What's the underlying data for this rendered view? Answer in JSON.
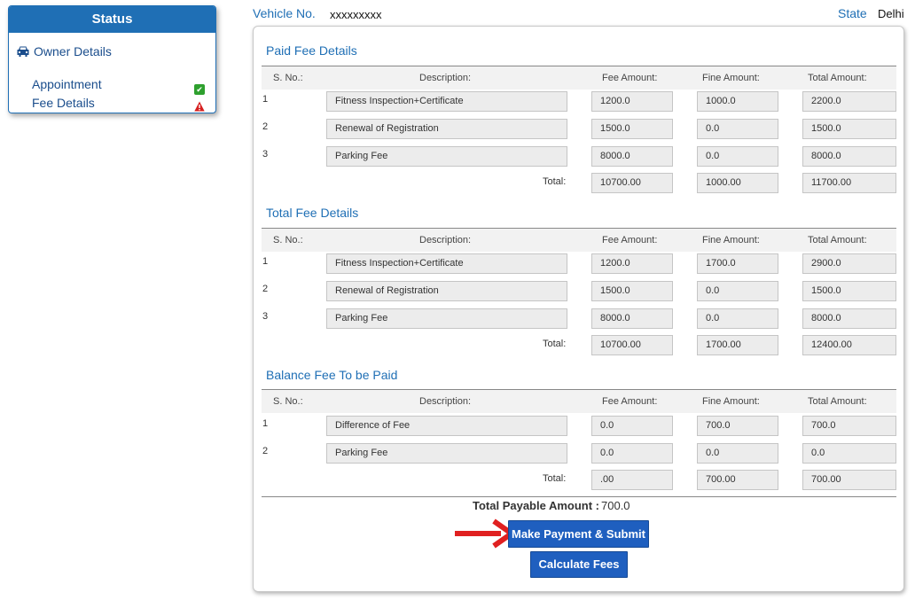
{
  "status_panel": {
    "title": "Status",
    "owner_details": "Owner Details",
    "appointment": "Appointment",
    "fee_details": "Fee Details"
  },
  "header": {
    "vehicle_label": "Vehicle No.",
    "vehicle_value": "xxxxxxxxx",
    "state_label": "State",
    "state_value": "Delhi"
  },
  "columns": {
    "sno": "S. No.:",
    "description": "Description:",
    "fee": "Fee Amount:",
    "fine": "Fine Amount:",
    "total": "Total Amount:"
  },
  "paid": {
    "title": "Paid Fee Details",
    "rows": [
      {
        "n": "1",
        "desc": "Fitness Inspection+Certificate",
        "fee": "1200.0",
        "fine": "1000.0",
        "total": "2200.0"
      },
      {
        "n": "2",
        "desc": "Renewal of Registration",
        "fee": "1500.0",
        "fine": "0.0",
        "total": "1500.0"
      },
      {
        "n": "3",
        "desc": "Parking Fee",
        "fee": "8000.0",
        "fine": "0.0",
        "total": "8000.0"
      }
    ],
    "total_label": "Total:",
    "total_fee": "10700.00",
    "total_fine": "1000.00",
    "total_total": "11700.00"
  },
  "total": {
    "title": "Total Fee Details",
    "rows": [
      {
        "n": "1",
        "desc": "Fitness Inspection+Certificate",
        "fee": "1200.0",
        "fine": "1700.0",
        "total": "2900.0"
      },
      {
        "n": "2",
        "desc": "Renewal of Registration",
        "fee": "1500.0",
        "fine": "0.0",
        "total": "1500.0"
      },
      {
        "n": "3",
        "desc": "Parking Fee",
        "fee": "8000.0",
        "fine": "0.0",
        "total": "8000.0"
      }
    ],
    "total_label": "Total:",
    "total_fee": "10700.00",
    "total_fine": "1700.00",
    "total_total": "12400.00"
  },
  "balance": {
    "title": "Balance Fee To be Paid",
    "rows": [
      {
        "n": "1",
        "desc": "Difference of Fee",
        "fee": "0.0",
        "fine": "700.0",
        "total": "700.0"
      },
      {
        "n": "2",
        "desc": "Parking Fee",
        "fee": "0.0",
        "fine": "0.0",
        "total": "0.0"
      }
    ],
    "total_label": "Total:",
    "total_fee": ".00",
    "total_fine": "700.00",
    "total_total": "700.00"
  },
  "payable": {
    "label": "Total Payable Amount :",
    "value": "700.0"
  },
  "buttons": {
    "submit": "Make Payment & Submit",
    "calculate": "Calculate Fees"
  },
  "icons": {
    "owner": "car-icon",
    "appointment_status": "check-icon",
    "fee_status": "warning-icon"
  },
  "colors": {
    "accent": "#1f6fb5",
    "button": "#1f5fbf",
    "arrow": "#e02020",
    "ok": "#2ea02e",
    "warn": "#d62020"
  }
}
